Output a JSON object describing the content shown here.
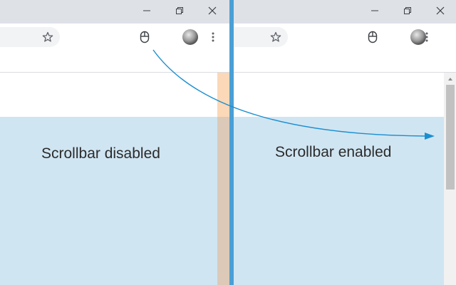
{
  "left_window": {
    "label": "Scrollbar disabled",
    "window_controls": [
      "minimize-icon",
      "restore-icon",
      "close-icon"
    ],
    "toolbar_icons": [
      "star-icon",
      "mouse-icon",
      "avatar",
      "more-vert-icon"
    ]
  },
  "right_window": {
    "label": "Scrollbar enabled",
    "window_controls": [
      "minimize-icon",
      "restore-icon",
      "close-icon"
    ],
    "toolbar_icons": [
      "star-icon",
      "mouse-icon",
      "avatar",
      "more-vert-icon"
    ]
  },
  "colors": {
    "titlebar": "#dee1e6",
    "content_blue": "#d0e5f2",
    "divider": "#4a9fd5",
    "arrow": "#1a8fd0",
    "orange_strip": "#fbd8b8"
  }
}
